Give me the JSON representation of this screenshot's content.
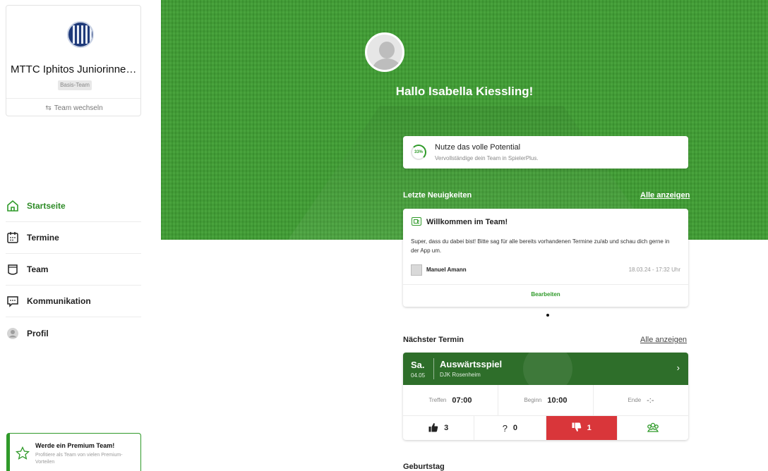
{
  "team": {
    "name": "MTTC Iphitos Juniorinnen...",
    "badge": "Basis-Team",
    "switch_label": "Team wechseln"
  },
  "nav": [
    {
      "label": "Startseite",
      "icon": "home-icon",
      "active": true
    },
    {
      "label": "Termine",
      "icon": "calendar-icon"
    },
    {
      "label": "Team",
      "icon": "shirt-icon"
    },
    {
      "label": "Kommunikation",
      "icon": "chat-icon"
    },
    {
      "label": "Profil",
      "icon": "profile-icon"
    }
  ],
  "premium": {
    "title": "Werde ein Premium Team!",
    "subtitle": "Profitiere als Team von vielen Premium-Vorteilen"
  },
  "greeting": "Hallo Isabella Kiessling!",
  "potential": {
    "percent_label": "33%",
    "title": "Nutze das volle Potential",
    "subtitle": "Vervollständige dein Team in SpielerPlus."
  },
  "news_section": {
    "heading": "Letzte Neuigkeiten",
    "show_all": "Alle anzeigen"
  },
  "news": {
    "title": "Willkommen im Team!",
    "body": "Super, dass du dabei bist! Bitte sag für alle bereits vorhandenen Termine zu/ab und schau dich gerne in der App um.",
    "author": "Manuel Amann",
    "date": "18.03.24 - 17:32 Uhr",
    "edit": "Bearbeiten"
  },
  "event_section": {
    "heading": "Nächster Termin",
    "show_all": "Alle anzeigen"
  },
  "event": {
    "day": "Sa.",
    "date": "04.05",
    "title": "Auswärtsspiel",
    "location": "DJK Rosenheim",
    "meet_label": "Treffen",
    "meet_time": "07:00",
    "start_label": "Beginn",
    "start_time": "10:00",
    "end_label": "Ende",
    "end_time": "-:-",
    "yes_count": "3",
    "maybe_count": "0",
    "no_count": "1"
  },
  "birthday_heading": "Geburtstag",
  "colors": {
    "brand_green": "#2f9a29",
    "hero_green": "#3f9e33",
    "event_header": "#2e6e2a",
    "decline_red": "#d9363a"
  }
}
